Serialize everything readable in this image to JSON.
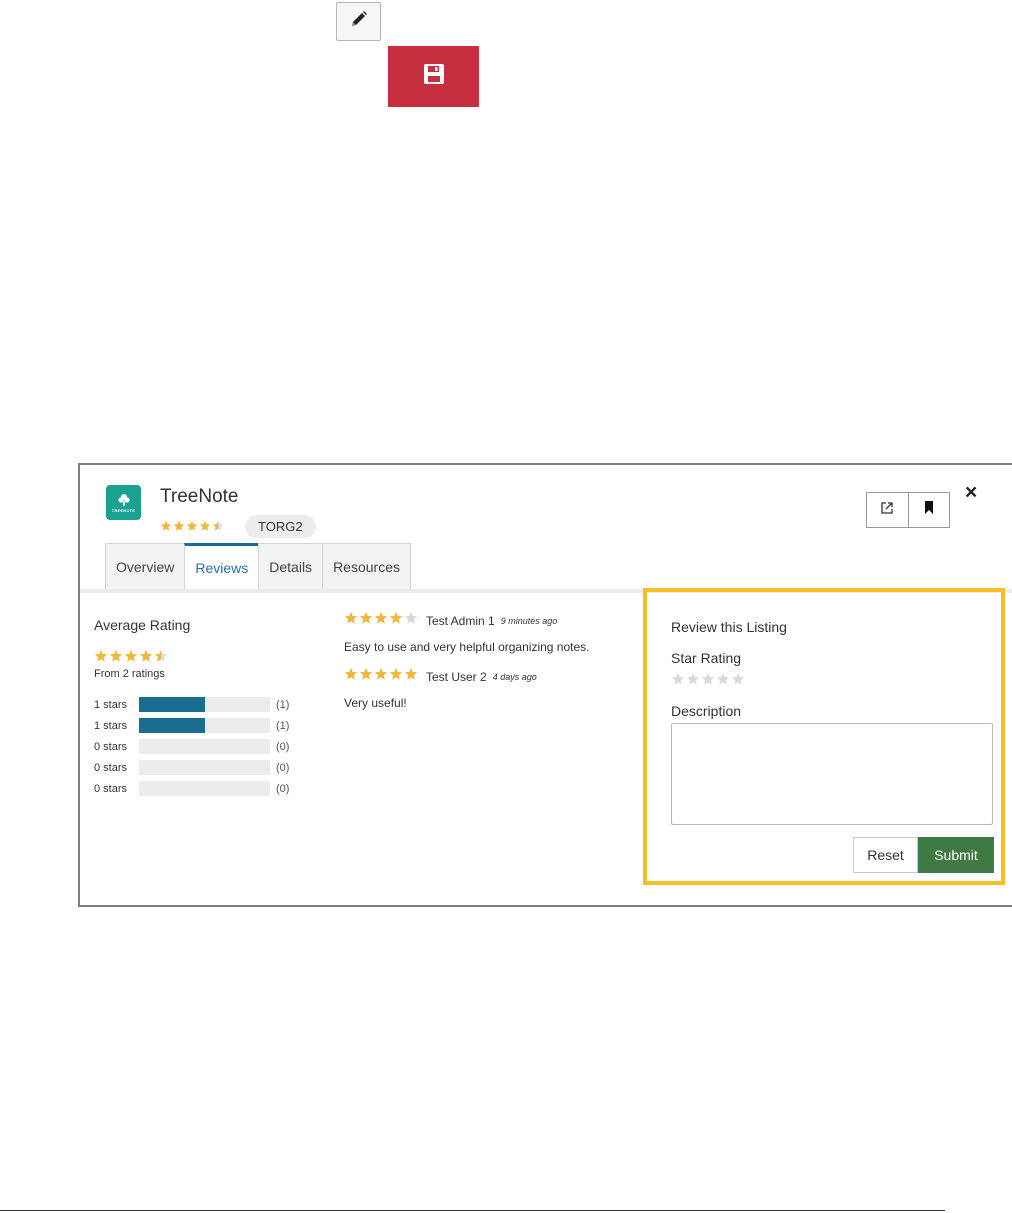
{
  "toolbar": {
    "edit_icon": "pencil-icon",
    "save_icon": "floppy-disk-icon",
    "save_color": "#c62f3e"
  },
  "listing": {
    "app_name": "TreeNote",
    "icon_text": "TREENOTE",
    "icon_color": "#1aa190",
    "header_rating": 4.5,
    "org_badge": "TORG2",
    "tabs": [
      {
        "label": "Overview",
        "active": false
      },
      {
        "label": "Reviews",
        "active": true
      },
      {
        "label": "Details",
        "active": false
      },
      {
        "label": "Resources",
        "active": false
      }
    ],
    "actions": {
      "launch_icon": "external-link-icon",
      "bookmark_icon": "bookmark-icon",
      "close_label": "×"
    }
  },
  "average": {
    "title": "Average Rating",
    "rating": 4.5,
    "from_text": "From 2 ratings",
    "histogram": [
      {
        "label": "1 stars",
        "count_text": "(1)",
        "fill": 0.5
      },
      {
        "label": "1 stars",
        "count_text": "(1)",
        "fill": 0.5
      },
      {
        "label": "0 stars",
        "count_text": "(0)",
        "fill": 0
      },
      {
        "label": "0 stars",
        "count_text": "(0)",
        "fill": 0
      },
      {
        "label": "0 stars",
        "count_text": "(0)",
        "fill": 0
      }
    ]
  },
  "reviews": [
    {
      "rating": 4,
      "author": "Test Admin 1",
      "time": "9 minutes ago",
      "text": "Easy to use and very helpful organizing notes."
    },
    {
      "rating": 5,
      "author": "Test User 2",
      "time": "4 days ago",
      "text": "Very useful!"
    }
  ],
  "form": {
    "title": "Review this Listing",
    "star_label": "Star Rating",
    "rating": 0,
    "desc_label": "Description",
    "desc_value": "",
    "reset_label": "Reset",
    "submit_label": "Submit",
    "highlight_color": "#f6bf26",
    "submit_color": "#3f7a43"
  },
  "colors": {
    "star_filled": "#f0b73b",
    "star_empty": "#d9d9d9",
    "accent": "#196e8f"
  }
}
